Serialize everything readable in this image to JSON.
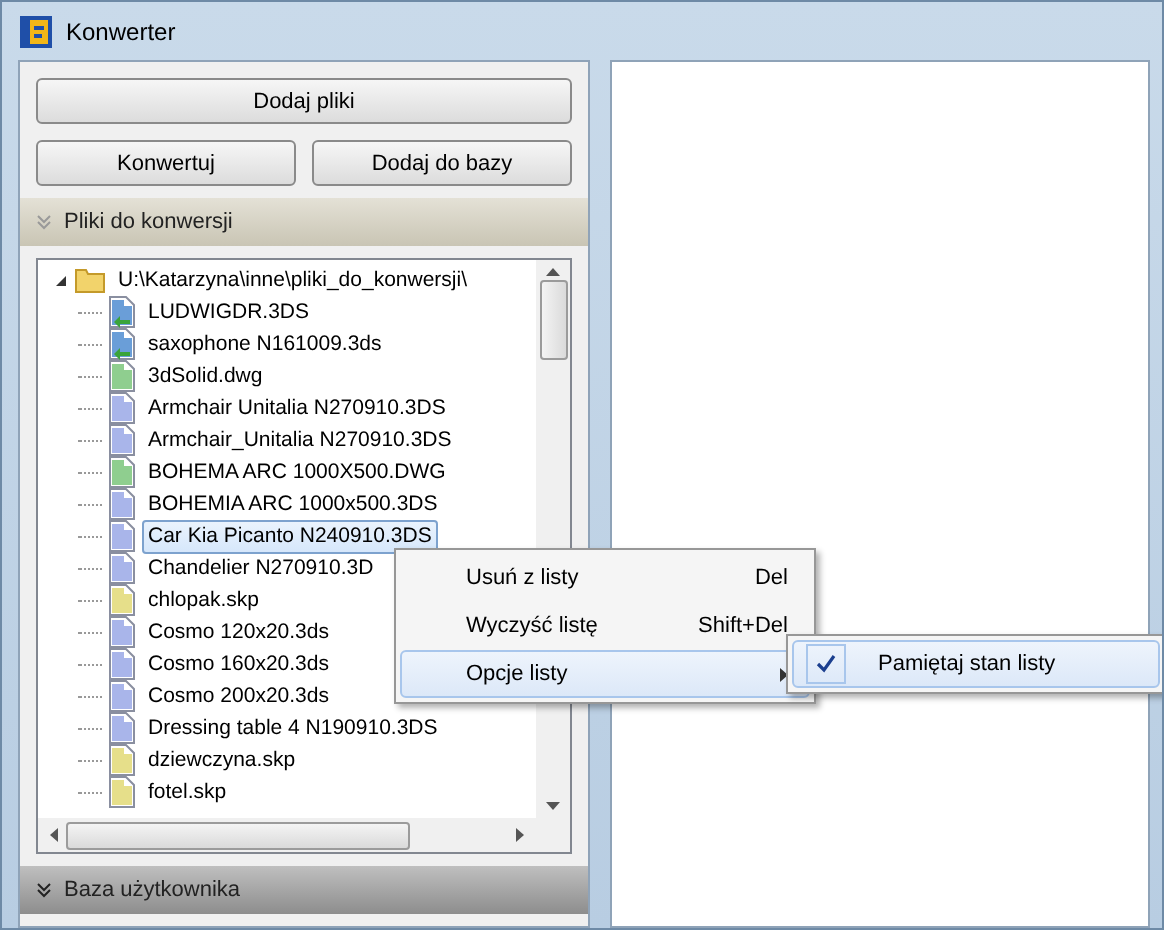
{
  "window": {
    "title": "Konwerter"
  },
  "buttons": {
    "add_files": "Dodaj pliki",
    "convert": "Konwertuj",
    "add_to_db": "Dodaj do bazy"
  },
  "sections": [
    {
      "label": "Pliki do konwersji",
      "expanded": true
    },
    {
      "label": "Baza użytkownika",
      "expanded": false
    }
  ],
  "tree": {
    "root": {
      "label": "U:\\Katarzyna\\inne\\pliki_do_konwersji\\",
      "expanded": true,
      "children": [
        {
          "label": "LUDWIGDR.3DS",
          "color": "#6a9ed8",
          "converted": true,
          "selected": false
        },
        {
          "label": "saxophone N161009.3ds",
          "color": "#6a9ed8",
          "converted": true,
          "selected": false
        },
        {
          "label": "3dSolid.dwg",
          "color": "#8fce8f",
          "converted": false,
          "selected": false
        },
        {
          "label": "Armchair Unitalia N270910.3DS",
          "color": "#a9b5ea",
          "converted": false,
          "selected": false
        },
        {
          "label": "Armchair_Unitalia N270910.3DS",
          "color": "#a9b5ea",
          "converted": false,
          "selected": false
        },
        {
          "label": "BOHEMA ARC 1000X500.DWG",
          "color": "#8fce8f",
          "converted": false,
          "selected": false
        },
        {
          "label": "BOHEMIA ARC 1000x500.3DS",
          "color": "#a9b5ea",
          "converted": false,
          "selected": false
        },
        {
          "label": "Car Kia Picanto N240910.3DS",
          "color": "#a9b5ea",
          "converted": false,
          "selected": true
        },
        {
          "label": "Chandelier N270910.3D",
          "color": "#a9b5ea",
          "converted": false,
          "selected": false
        },
        {
          "label": "chlopak.skp",
          "color": "#e6df8a",
          "converted": false,
          "selected": false
        },
        {
          "label": "Cosmo 120x20.3ds",
          "color": "#a9b5ea",
          "converted": false,
          "selected": false
        },
        {
          "label": "Cosmo 160x20.3ds",
          "color": "#a9b5ea",
          "converted": false,
          "selected": false
        },
        {
          "label": "Cosmo 200x20.3ds",
          "color": "#a9b5ea",
          "converted": false,
          "selected": false
        },
        {
          "label": "Dressing table 4 N190910.3DS",
          "color": "#a9b5ea",
          "converted": false,
          "selected": false
        },
        {
          "label": "dziewczyna.skp",
          "color": "#e6df8a",
          "converted": false,
          "selected": false
        },
        {
          "label": "fotel.skp",
          "color": "#e6df8a",
          "converted": false,
          "selected": false
        }
      ]
    }
  },
  "context_menu": {
    "items": [
      {
        "label": "Usuń z listy",
        "shortcut": "Del",
        "kind": "command",
        "selected": false
      },
      {
        "label": "Wyczyść listę",
        "shortcut": "Shift+Del",
        "kind": "command",
        "selected": false
      },
      {
        "label": "Opcje listy",
        "kind": "submenu",
        "selected": true
      }
    ],
    "submenu": [
      {
        "label": "Pamiętaj stan listy",
        "checked": true
      }
    ]
  }
}
